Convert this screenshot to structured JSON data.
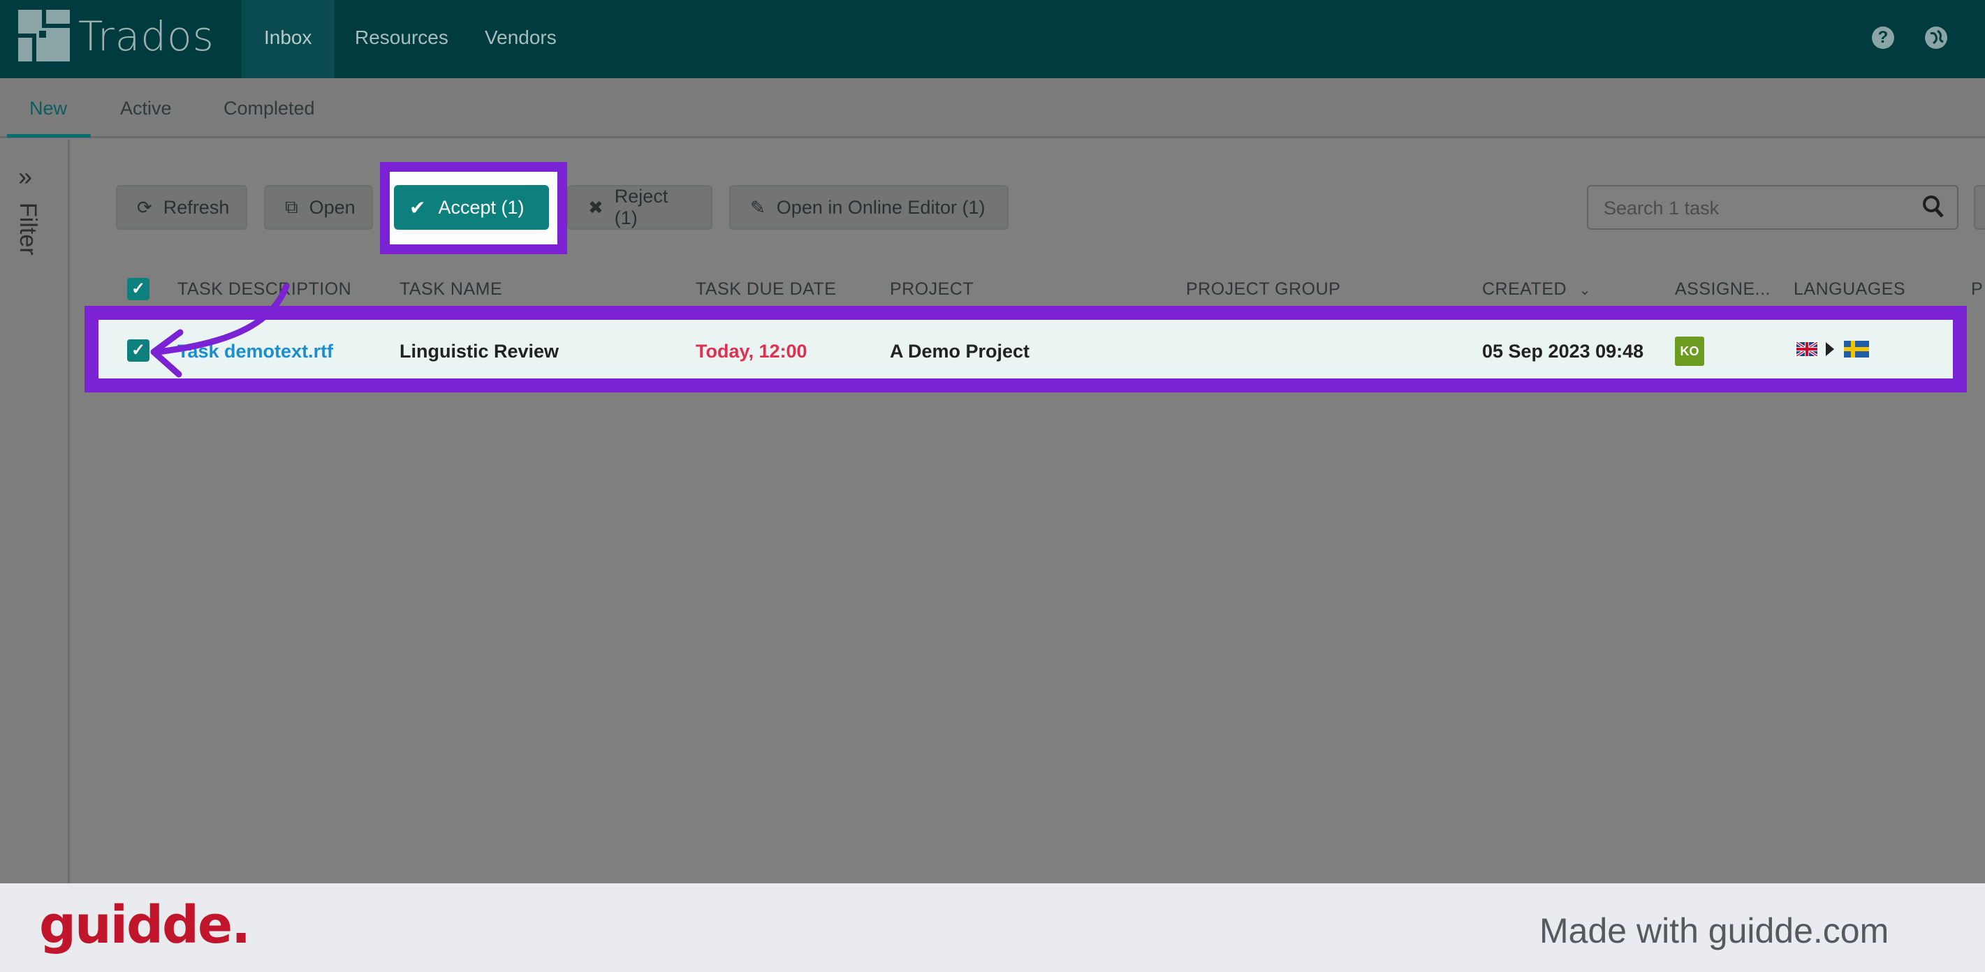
{
  "app": {
    "title": "Trados"
  },
  "nav": {
    "items": [
      {
        "label": "Inbox",
        "active": true
      },
      {
        "label": "Resources",
        "active": false
      },
      {
        "label": "Vendors",
        "active": false
      }
    ],
    "right_icons": [
      "help-icon",
      "globe-icon"
    ]
  },
  "subtabs": [
    {
      "label": "New",
      "active": true
    },
    {
      "label": "Active",
      "active": false
    },
    {
      "label": "Completed",
      "active": false
    }
  ],
  "filter": {
    "label": "Filter",
    "icon": "double-chevron-right-icon"
  },
  "toolbar": {
    "refresh": "Refresh",
    "open": "Open",
    "accept": "Accept (1)",
    "reject": "Reject (1)",
    "online_editor": "Open in Online Editor (1)"
  },
  "search": {
    "placeholder": "Search 1 task"
  },
  "table": {
    "headers": [
      "TASK DESCRIPTION",
      "TASK NAME",
      "TASK DUE DATE",
      "PROJECT",
      "PROJECT GROUP",
      "CREATED",
      "ASSIGNE...",
      "LANGUAGES",
      "P"
    ],
    "rows": [
      {
        "description": "Task demotext.rtf",
        "name": "Linguistic Review",
        "due": "Today, 12:00",
        "project": "A Demo Project",
        "group": "",
        "created": "05 Sep 2023 09:48",
        "assignee": "KO",
        "languages": {
          "source_flag": "uk-flag-icon",
          "target_flag": "sweden-flag-icon"
        }
      }
    ]
  },
  "colors": {
    "highlight": "#7b22d4",
    "accent": "#0d7f7c",
    "due": "#e02f4f",
    "nav": "#003c3f"
  },
  "footer": {
    "brand": "guidde.",
    "made_with": "Made with guidde.com"
  }
}
